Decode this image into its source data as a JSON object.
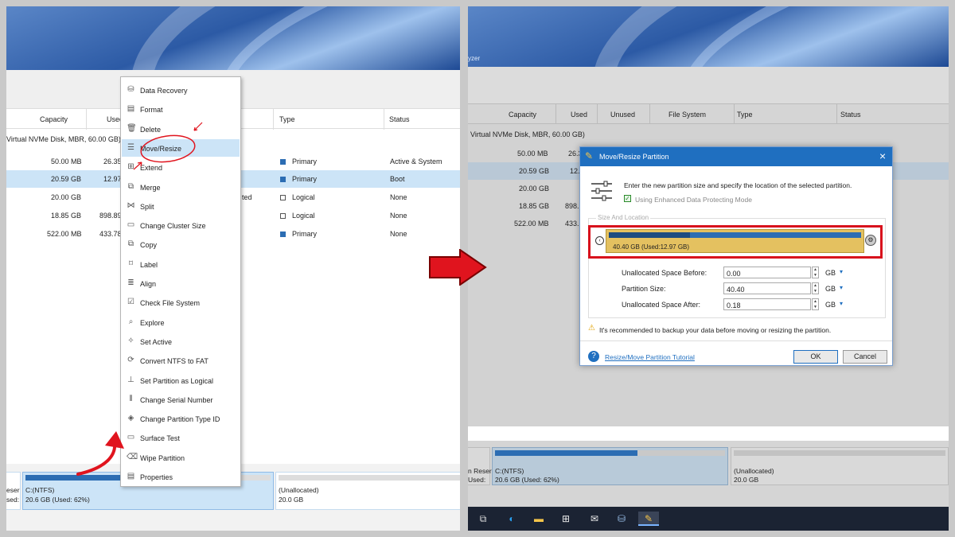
{
  "left": {
    "columns": [
      "Capacity",
      "Used",
      "Type",
      "Status"
    ],
    "disk_label": "Virtual NVMe Disk, MBR, 60.00 GB)",
    "rows": [
      {
        "capacity": "50.00 MB",
        "used": "26.35",
        "type": "Primary",
        "status": "Active & System",
        "type_icon": "filled"
      },
      {
        "capacity": "20.59 GB",
        "used": "12.97",
        "type": "Primary",
        "status": "Boot",
        "type_icon": "filled"
      },
      {
        "capacity": "20.00 GB",
        "used": "",
        "extra": "ted",
        "type": "Logical",
        "status": "None",
        "type_icon": "hollow"
      },
      {
        "capacity": "18.85 GB",
        "used": "898.89",
        "type": "Logical",
        "status": "None",
        "type_icon": "hollow"
      },
      {
        "capacity": "522.00 MB",
        "used": "433.78",
        "type": "Primary",
        "status": "None",
        "type_icon": "filled"
      }
    ],
    "map": [
      {
        "line1": "eser",
        "line2": "sed:"
      },
      {
        "line1": "C:(NTFS)",
        "line2": "20.6 GB (Used: 62%)",
        "used_pct": 62
      },
      {
        "line1": "(Unallocated)",
        "line2": "20.0 GB",
        "used_pct": 0
      }
    ]
  },
  "menu": {
    "items": [
      {
        "label": "Data Recovery",
        "icon": "data-recovery-icon",
        "glyph": "⛁"
      },
      {
        "label": "Format",
        "icon": "format-icon",
        "glyph": "▤"
      },
      {
        "label": "Delete",
        "icon": "delete-icon",
        "glyph": "🗑"
      },
      {
        "label": "Move/Resize",
        "icon": "move-resize-icon",
        "glyph": "☰"
      },
      {
        "label": "Extend",
        "icon": "extend-icon",
        "glyph": "⊞"
      },
      {
        "label": "Merge",
        "icon": "merge-icon",
        "glyph": "⧉"
      },
      {
        "label": "Split",
        "icon": "split-icon",
        "glyph": "⋈"
      },
      {
        "label": "Change Cluster Size",
        "icon": "cluster-size-icon",
        "glyph": "▭"
      },
      {
        "label": "Copy",
        "icon": "copy-icon",
        "glyph": "⧉"
      },
      {
        "label": "Label",
        "icon": "label-icon",
        "glyph": "⌑"
      },
      {
        "label": "Align",
        "icon": "align-icon",
        "glyph": "≣"
      },
      {
        "label": "Check File System",
        "icon": "check-file-system-icon",
        "glyph": "☑"
      },
      {
        "label": "Explore",
        "icon": "explore-icon",
        "glyph": "⌕"
      },
      {
        "label": "Set Active",
        "icon": "set-active-icon",
        "glyph": "✧"
      },
      {
        "label": "Convert NTFS to FAT",
        "icon": "convert-icon",
        "glyph": "⟳"
      },
      {
        "label": "Set Partition as Logical",
        "icon": "set-logical-icon",
        "glyph": "⊥"
      },
      {
        "label": "Change Serial Number",
        "icon": "serial-number-icon",
        "glyph": "⦀"
      },
      {
        "label": "Change Partition Type ID",
        "icon": "type-id-icon",
        "glyph": "◈"
      },
      {
        "label": "Surface Test",
        "icon": "surface-test-icon",
        "glyph": "▭"
      },
      {
        "label": "Wipe Partition",
        "icon": "wipe-icon",
        "glyph": "⌫"
      },
      {
        "label": "Properties",
        "icon": "properties-icon",
        "glyph": "▤"
      }
    ],
    "highlighted": "Move/Resize"
  },
  "right": {
    "banner_text": "yzer",
    "columns": [
      "Capacity",
      "Used",
      "Unused",
      "File System",
      "Type",
      "Status"
    ],
    "disk_label": "Virtual NVMe Disk, MBR, 60.00 GB)",
    "rows": [
      {
        "capacity": "50.00 MB",
        "used": "26.3"
      },
      {
        "capacity": "20.59 GB",
        "used": "12."
      },
      {
        "capacity": "20.00 GB",
        "used": ""
      },
      {
        "capacity": "18.85 GB",
        "used": "898."
      },
      {
        "capacity": "522.00 MB",
        "used": "433."
      }
    ],
    "map": [
      {
        "line1": "n Reser",
        "line2": "Used:"
      },
      {
        "line1": "C:(NTFS)",
        "line2": "20.6 GB (Used: 62%)",
        "used_pct": 62
      },
      {
        "line1": "(Unallocated)",
        "line2": "20.0 GB",
        "used_pct": 0
      }
    ]
  },
  "dialog": {
    "title": "Move/Resize Partition",
    "close": "×",
    "instruction": "Enter the new partition size and specify the location of the selected partition.",
    "checkbox_label": "Using Enhanced Data Protecting Mode",
    "checkbox_checked": true,
    "section_label": "Size And Location",
    "partition_bar_label": "40.40 GB (Used:12.97 GB)",
    "partition_used_fraction": 0.32,
    "fields": [
      {
        "label": "Unallocated Space Before:",
        "value": "0.00",
        "unit": "GB"
      },
      {
        "label": "Partition Size:",
        "value": "40.40",
        "unit": "GB"
      },
      {
        "label": "Unallocated Space After:",
        "value": "0.18",
        "unit": "GB"
      }
    ],
    "warning": "It's recommended to backup your data before moving or resizing the partition.",
    "tutorial_link": "Resize/Move Partition Tutorial",
    "ok_label": "OK",
    "cancel_label": "Cancel"
  },
  "colors": {
    "accent": "#1f6fc0",
    "highlight": "#cce4f7",
    "annotation_red": "#e0141e"
  },
  "taskbar": {
    "icons": [
      "task-view-icon",
      "edge-icon",
      "file-explorer-icon",
      "store-icon",
      "mail-icon",
      "disk-tool-icon",
      "partition-wizard-icon"
    ]
  }
}
